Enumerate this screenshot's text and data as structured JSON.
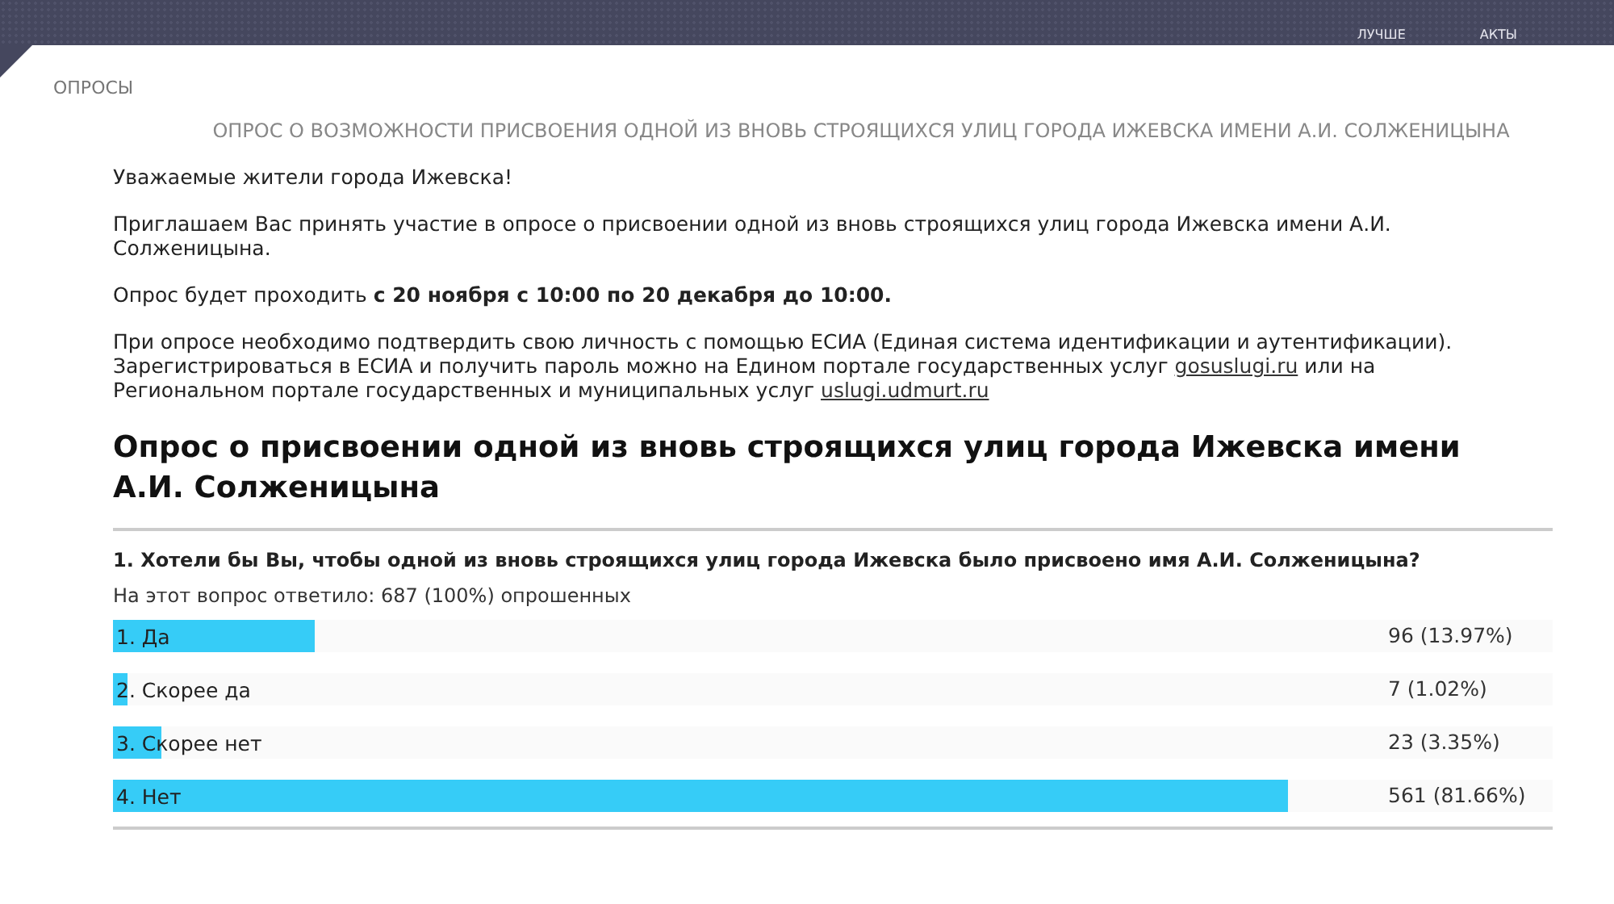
{
  "nav": {
    "items": [
      "ЛУЧШЕ",
      "АКТЫ"
    ]
  },
  "breadcrumb": "ОПРОСЫ",
  "page_title": "ОПРОС О ВОЗМОЖНОСТИ ПРИСВОЕНИЯ ОДНОЙ ИЗ ВНОВЬ СТРОЯЩИХСЯ УЛИЦ ГОРОДА ИЖЕВСКА ИМЕНИ А.И. СОЛЖЕНИЦЫНА",
  "intro": {
    "greeting": "Уважаемые жители города Ижевска!",
    "invitation": "Приглашаем Вас принять участие в опросе о присвоении одной из вновь строящихся улиц города Ижевска имени А.И. Солженицына.",
    "schedule": "Опрос будет проходить **с 20 ноября с 10:00 по 20 декабря до 10:00.**",
    "esia_text": "При опросе необходимо подтвердить свою личность с помощью ЕСИА (Единая система идентификации и аутентификации). Зарегистрироваться в ЕСИА и получить пароль можно на Едином портале государственных услуг",
    "link_1": "gosuslugi.ru",
    "esia_middle": "или на Региональном портале государственных и муниципальных услуг",
    "link_2": "uslugi.udmurt.ru"
  },
  "survey": {
    "title": "Опрос о присвоении одной из вновь строящихся улиц города Ижевска имени А.И. Солженицына",
    "questions": [
      {
        "text": "1. Хотели бы Вы, чтобы одной из вновь строящихся улиц города Ижевска было присвоено имя А.И. Солженицына?",
        "answered": "На этот вопрос ответило: 687 (100%) опрошенных",
        "answers": [
          {
            "label": "1. Да",
            "level": 0.1397,
            "result": "96 (13.97%)"
          },
          {
            "label": "2. Скорее да",
            "level": 0.0102,
            "result": "7 (1.02%)"
          },
          {
            "label": "3. Скорее нет",
            "level": 0.0335,
            "result": "23 (3.35%)"
          },
          {
            "label": "4. Нет",
            "level": 0.8166,
            "result": "561 (81.66%)"
          }
        ]
      }
    ]
  }
}
